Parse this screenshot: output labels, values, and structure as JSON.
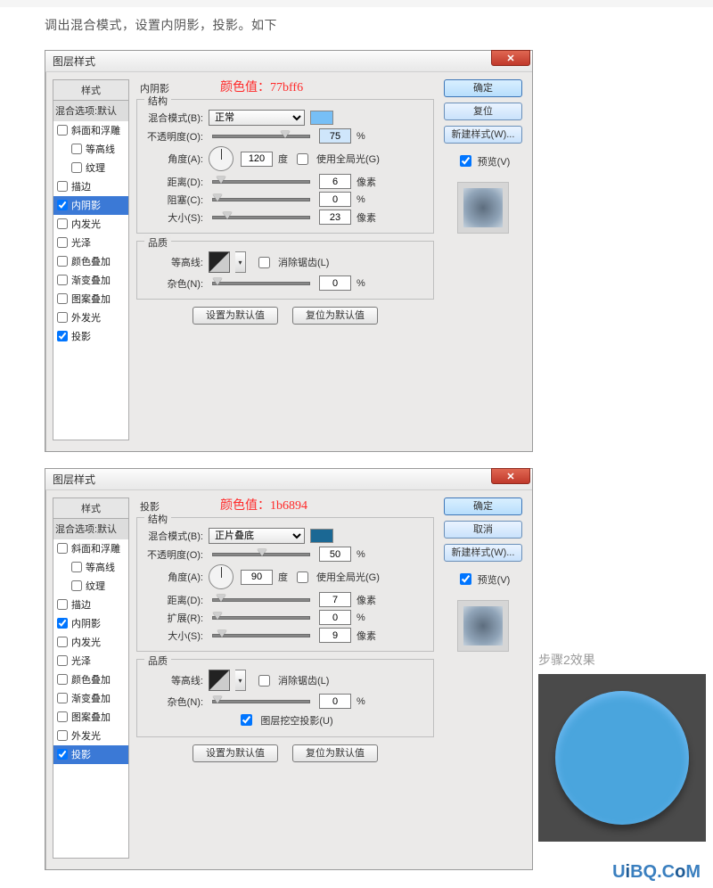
{
  "intro": "调出混合模式，设置内阴影，投影。如下",
  "dialog_title": "图层样式",
  "close_glyph": "✕",
  "styles_header": "样式",
  "blend_options": "混合选项:默认",
  "style_items": [
    "斜面和浮雕",
    "等高线",
    "纹理",
    "描边",
    "内阴影",
    "内发光",
    "光泽",
    "颜色叠加",
    "渐变叠加",
    "图案叠加",
    "外发光",
    "投影"
  ],
  "right": {
    "ok": "确定",
    "reset": "复位",
    "cancel": "取消",
    "new_style": "新建样式(W)...",
    "preview": "预览(V)"
  },
  "labels": {
    "structure": "结构",
    "quality": "品质",
    "blend_mode": "混合模式(B):",
    "opacity": "不透明度(O):",
    "angle": "角度(A):",
    "distance": "距离(D):",
    "choke": "阻塞(C):",
    "spread": "扩展(R):",
    "size": "大小(S):",
    "contour": "等高线:",
    "anti_alias": "消除锯齿(L)",
    "noise": "杂色(N):",
    "knockout": "图层挖空投影(U)",
    "use_global": "使用全局光(G)",
    "deg": "度",
    "pct": "%",
    "px": "像素",
    "reset_default": "设置为默认值",
    "restore_default": "复位为默认值"
  },
  "panel1": {
    "title": "内阴影",
    "color_label": "颜色值：77bff6",
    "swatch_color": "#77bff6",
    "blend_mode": "正常",
    "opacity": "75",
    "angle": "120",
    "distance": "6",
    "choke": "0",
    "size": "23",
    "noise": "0"
  },
  "panel2": {
    "title": "投影",
    "color_label": "颜色值：1b6894",
    "swatch_color": "#1b6894",
    "blend_mode": "正片叠底",
    "opacity": "50",
    "angle": "90",
    "distance": "7",
    "spread": "0",
    "size": "9",
    "noise": "0"
  },
  "step2_label": "步骤2效果",
  "watermark": {
    "a": "U",
    "b": "i",
    "c": "BQ.",
    "d": "C",
    "e": "o",
    "f": "M"
  }
}
